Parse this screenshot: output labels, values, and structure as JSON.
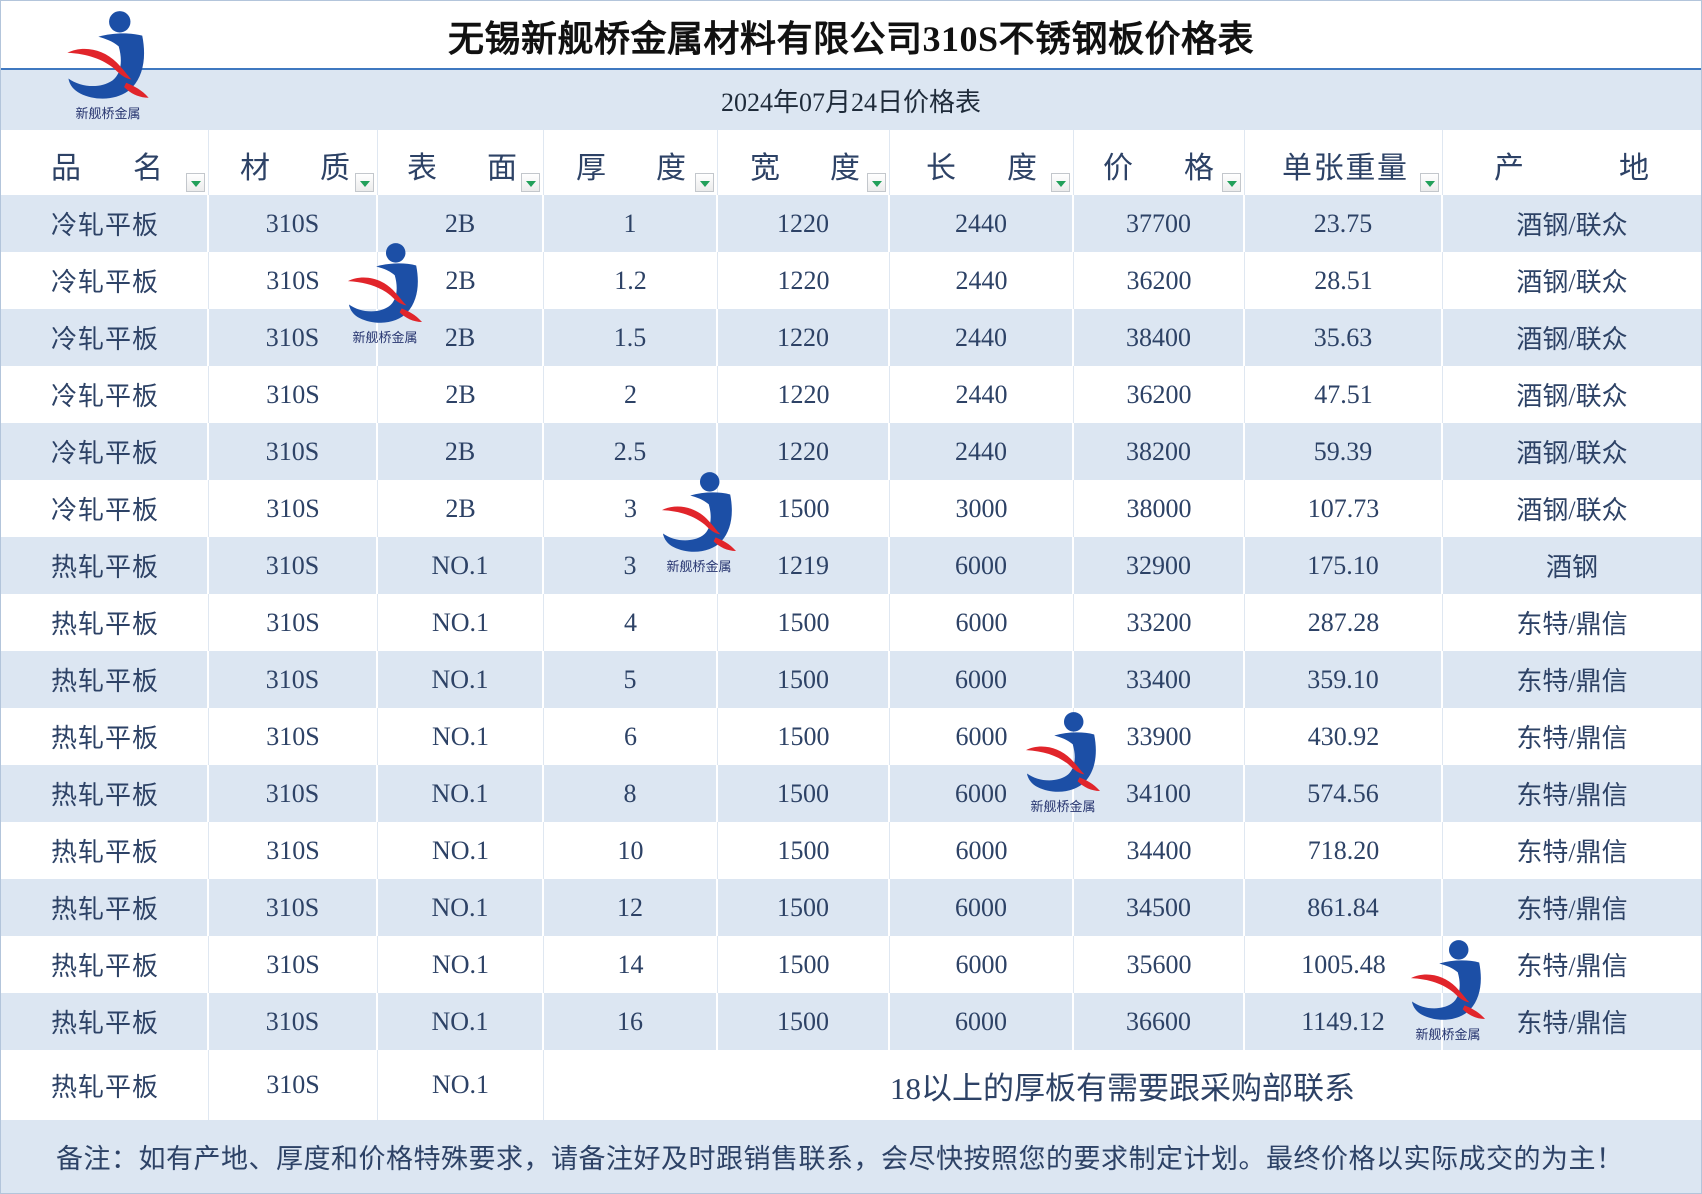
{
  "title": "无锡新舰桥金属材料有限公司310S不锈钢板价格表",
  "date_label": "2024年07月24日价格表",
  "logo": {
    "icon": "company-logo-icon",
    "text": "新舰桥金属"
  },
  "colors": {
    "band": "#dce6f2",
    "text": "#2d4266",
    "rule": "#3f78c0",
    "logo_blue": "#1c4fa6",
    "logo_red": "#e1252b",
    "filter_arrow": "#22a05a"
  },
  "filter_icon": "filter-arrow-icon",
  "columns": [
    {
      "label": "品名",
      "filter": true
    },
    {
      "label": "材质",
      "filter": true
    },
    {
      "label": "表面",
      "filter": true
    },
    {
      "label": "厚度",
      "filter": true
    },
    {
      "label": "宽度",
      "filter": true
    },
    {
      "label": "长度",
      "filter": true
    },
    {
      "label": "价格",
      "filter": true
    },
    {
      "label": "单张重量",
      "filter": true
    },
    {
      "label": "产地",
      "filter": false
    }
  ],
  "rows": [
    [
      "冷轧平板",
      "310S",
      "2B",
      "1",
      "1220",
      "2440",
      "37700",
      "23.75",
      "酒钢/联众"
    ],
    [
      "冷轧平板",
      "310S",
      "2B",
      "1.2",
      "1220",
      "2440",
      "36200",
      "28.51",
      "酒钢/联众"
    ],
    [
      "冷轧平板",
      "310S",
      "2B",
      "1.5",
      "1220",
      "2440",
      "38400",
      "35.63",
      "酒钢/联众"
    ],
    [
      "冷轧平板",
      "310S",
      "2B",
      "2",
      "1220",
      "2440",
      "36200",
      "47.51",
      "酒钢/联众"
    ],
    [
      "冷轧平板",
      "310S",
      "2B",
      "2.5",
      "1220",
      "2440",
      "38200",
      "59.39",
      "酒钢/联众"
    ],
    [
      "冷轧平板",
      "310S",
      "2B",
      "3",
      "1500",
      "3000",
      "38000",
      "107.73",
      "酒钢/联众"
    ],
    [
      "热轧平板",
      "310S",
      "NO.1",
      "3",
      "1219",
      "6000",
      "32900",
      "175.10",
      "酒钢"
    ],
    [
      "热轧平板",
      "310S",
      "NO.1",
      "4",
      "1500",
      "6000",
      "33200",
      "287.28",
      "东特/鼎信"
    ],
    [
      "热轧平板",
      "310S",
      "NO.1",
      "5",
      "1500",
      "6000",
      "33400",
      "359.10",
      "东特/鼎信"
    ],
    [
      "热轧平板",
      "310S",
      "NO.1",
      "6",
      "1500",
      "6000",
      "33900",
      "430.92",
      "东特/鼎信"
    ],
    [
      "热轧平板",
      "310S",
      "NO.1",
      "8",
      "1500",
      "6000",
      "34100",
      "574.56",
      "东特/鼎信"
    ],
    [
      "热轧平板",
      "310S",
      "NO.1",
      "10",
      "1500",
      "6000",
      "34400",
      "718.20",
      "东特/鼎信"
    ],
    [
      "热轧平板",
      "310S",
      "NO.1",
      "12",
      "1500",
      "6000",
      "34500",
      "861.84",
      "东特/鼎信"
    ],
    [
      "热轧平板",
      "310S",
      "NO.1",
      "14",
      "1500",
      "6000",
      "35600",
      "1005.48",
      "东特/鼎信"
    ],
    [
      "热轧平板",
      "310S",
      "NO.1",
      "16",
      "1500",
      "6000",
      "36600",
      "1149.12",
      "东特/鼎信"
    ]
  ],
  "last_row": {
    "cells": [
      "热轧平板",
      "310S",
      "NO.1"
    ],
    "note": "18以上的厚板有需要跟采购部联系"
  },
  "footer_note": "备注：如有产地、厚度和价格特殊要求，请备注好及时跟销售联系，会尽快按照您的要求制定计划。最终价格以实际成交的为主！"
}
